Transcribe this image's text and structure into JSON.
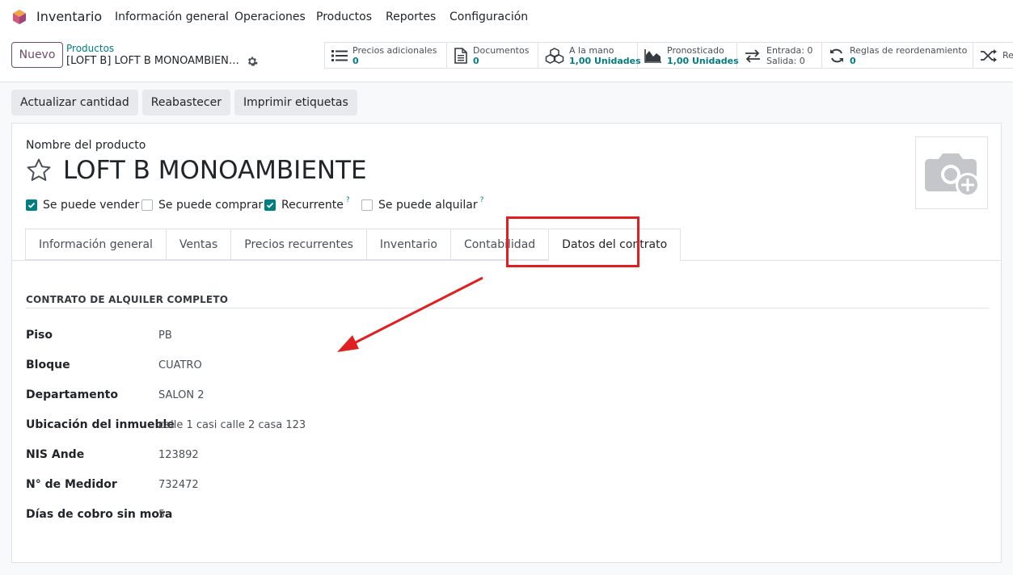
{
  "nav": {
    "app_name": "Inventario",
    "menu": [
      "Información general",
      "Operaciones",
      "Productos",
      "Reportes",
      "Configuración"
    ]
  },
  "control_panel": {
    "new_label": "Nuevo",
    "breadcrumb_parent": "Productos",
    "breadcrumb_current": "[LOFT B] LOFT B MONOAMBIEN…",
    "smart_buttons": [
      {
        "label": "Precios adicionales",
        "value": "0",
        "icon": "list-icon"
      },
      {
        "label": "Documentos",
        "value": "0",
        "icon": "document-icon"
      },
      {
        "label": "A la mano",
        "value": "1,00 Unidades",
        "icon": "cubes-icon"
      },
      {
        "label": "Pronosticado",
        "value": "1,00 Unidades",
        "icon": "area-chart-icon"
      },
      {
        "label": "Entrada: 0",
        "value": "Salida: 0",
        "icon": "exchange-icon"
      },
      {
        "label": "Reglas de reordenamiento",
        "value": "0",
        "icon": "refresh-icon"
      },
      {
        "label": "Re",
        "value": "",
        "icon": "random-icon"
      }
    ]
  },
  "actions": [
    "Actualizar cantidad",
    "Reabastecer",
    "Imprimir etiquetas"
  ],
  "form": {
    "name_label": "Nombre del producto",
    "product_name": "LOFT B MONOAMBIENTE",
    "checkboxes": [
      {
        "label": "Se puede vender",
        "checked": true,
        "help": ""
      },
      {
        "label": "Se puede comprar",
        "checked": false,
        "help": ""
      },
      {
        "label": "Recurrente",
        "checked": true,
        "help": "?"
      },
      {
        "label": "Se puede alquilar",
        "checked": false,
        "help": "?"
      }
    ],
    "tabs": [
      "Información general",
      "Ventas",
      "Precios recurrentes",
      "Inventario",
      "Contabilidad",
      "Datos del contrato"
    ],
    "active_tab": "Datos del contrato",
    "group_title": "CONTRATO DE ALQUILER COMPLETO",
    "fields": [
      {
        "label": "Piso",
        "value": "PB"
      },
      {
        "label": "Bloque",
        "value": "CUATRO"
      },
      {
        "label": "Departamento",
        "value": "SALON 2"
      },
      {
        "label": "Ubicación del inmueble",
        "value": "calle 1 casi calle 2 casa 123"
      },
      {
        "label": "NIS Ande",
        "value": "123892"
      },
      {
        "label": "N° de Medidor",
        "value": "732472"
      },
      {
        "label": "Días de cobro sin mora",
        "value": "5"
      }
    ]
  },
  "colors": {
    "brand": "#714b67",
    "teal": "#017e84",
    "annotation": "#e02020"
  }
}
